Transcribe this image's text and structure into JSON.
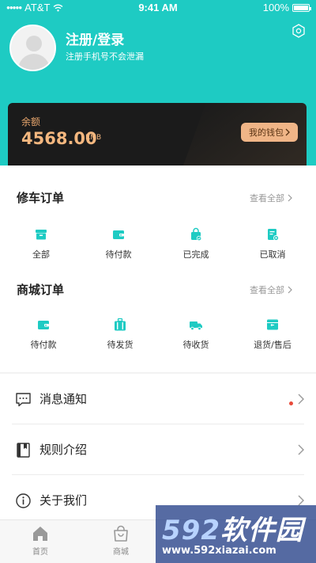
{
  "status_bar": {
    "carrier": "AT&T",
    "time": "9:41 AM",
    "battery": "100%"
  },
  "profile": {
    "title": "注册/登录",
    "subtitle": "注册手机号不会泄漏"
  },
  "wallet": {
    "balance_label": "余额",
    "balance_value": "4568.00",
    "unit": "RMB",
    "button_label": "我的钱包"
  },
  "repair_orders": {
    "title": "修车订单",
    "view_all": "查看全部",
    "items": [
      {
        "label": "全部",
        "icon": "box-icon"
      },
      {
        "label": "待付款",
        "icon": "wallet-icon"
      },
      {
        "label": "已完成",
        "icon": "bag-check-icon"
      },
      {
        "label": "已取消",
        "icon": "doc-cancel-icon"
      }
    ]
  },
  "mall_orders": {
    "title": "商城订单",
    "view_all": "查看全部",
    "items": [
      {
        "label": "待付款",
        "icon": "wallet-icon"
      },
      {
        "label": "待发货",
        "icon": "suitcase-icon"
      },
      {
        "label": "待收货",
        "icon": "truck-icon"
      },
      {
        "label": "退货/售后",
        "icon": "return-box-icon"
      }
    ]
  },
  "menu": [
    {
      "label": "消息通知",
      "icon": "message-icon",
      "badge": true
    },
    {
      "label": "规则介绍",
      "icon": "book-icon"
    },
    {
      "label": "关于我们",
      "icon": "info-icon"
    }
  ],
  "tabs": [
    {
      "label": "首页",
      "icon": "home-icon"
    },
    {
      "label": "商城",
      "icon": "shopping-bag-icon"
    }
  ],
  "watermark": {
    "brand_digits": "592",
    "brand_text": "软件园",
    "url": "www.592xiazai.com"
  },
  "colors": {
    "teal": "#1ecbc3",
    "wallet_bg": "#1b1b1b",
    "gold": "#f3b77f",
    "badge_red": "#e84a3a"
  }
}
